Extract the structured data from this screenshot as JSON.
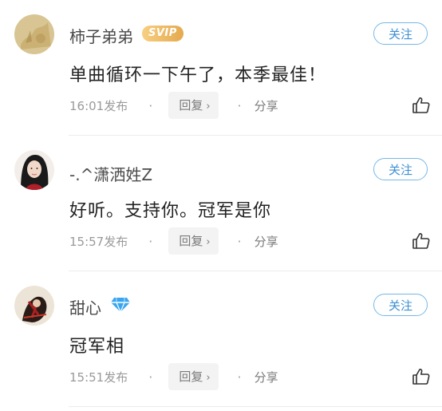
{
  "comments": [
    {
      "username": "柿子弟弟",
      "badge": "SVIP",
      "follow": "关注",
      "content": "单曲循环一下午了，本季最佳！",
      "time": "16:01发布",
      "reply": "回复",
      "share": "分享"
    },
    {
      "username": "-.^潇洒姓Z",
      "follow": "关注",
      "content": "好听。支持你。冠军是你",
      "time": "15:57发布",
      "reply": "回复",
      "share": "分享"
    },
    {
      "username": "甜心",
      "follow": "关注",
      "content": "冠军相",
      "time": "15:51发布",
      "reply": "回复",
      "share": "分享"
    }
  ],
  "icons": {
    "reply_chevron": "›",
    "separator": "·",
    "like": "thumbs-up-icon",
    "vip": "diamond-icon"
  },
  "colors": {
    "follow_border": "#76b8e8",
    "follow_text": "#3d8fd3",
    "svip_gold": "#e5a94e",
    "diamond_blue": "#3aa6ef"
  }
}
